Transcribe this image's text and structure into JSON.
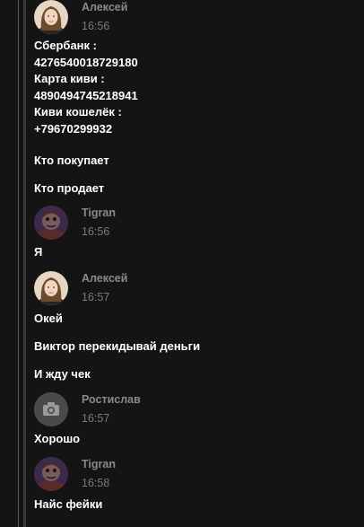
{
  "messages": [
    {
      "author": "Алексей",
      "time": "16:56",
      "avatar": "female-photo",
      "lines": [
        "Сбербанк :\n4276540018729180\nКарта киви :\n4890494745218941\nКиви кошелёк :\n+79670299932",
        "Кто покупает",
        "Кто продает"
      ]
    },
    {
      "author": "Tigran",
      "time": "16:56",
      "avatar": "character-photo",
      "lines": [
        "Я"
      ]
    },
    {
      "author": "Алексей",
      "time": "16:57",
      "avatar": "female-photo",
      "lines": [
        "Окей",
        "Виктор перекидывай деньги",
        "И жду чек"
      ]
    },
    {
      "author": "Ростислав",
      "time": "16:57",
      "avatar": "camera-icon",
      "lines": [
        "Хорошо"
      ]
    },
    {
      "author": "Tigran",
      "time": "16:58",
      "avatar": "character-photo",
      "lines": [
        "Найс фейки"
      ]
    }
  ]
}
